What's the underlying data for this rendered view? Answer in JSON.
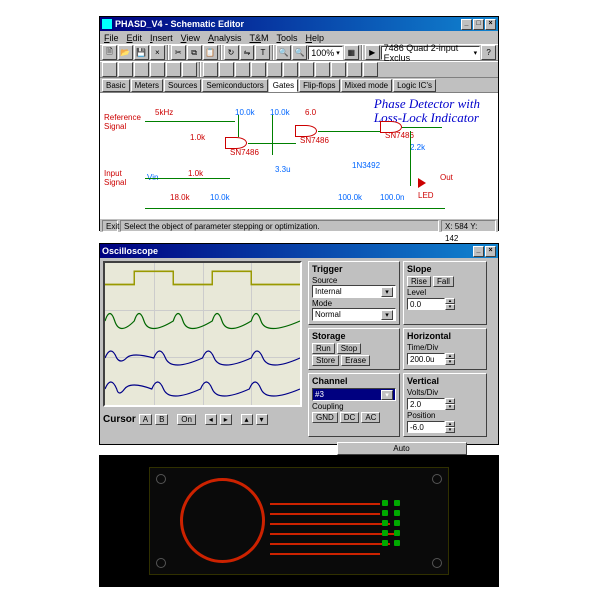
{
  "schematic": {
    "title": "PHASD_V4 - Schematic Editor",
    "menu": [
      "File",
      "Edit",
      "Insert",
      "View",
      "Analysis",
      "T&M",
      "Tools",
      "Help"
    ],
    "zoom": "100%",
    "component_sel": "7486 Quad 2-input Exclus",
    "tabs": [
      "Basic",
      "Meters",
      "Sources",
      "Semiconductors",
      "Gates",
      "Flip-flops",
      "Mixed mode",
      "Logic IC's"
    ],
    "drawing_title_line1": "Phase Detector with",
    "drawing_title_line2": "Loss-Lock Indicator",
    "labels": {
      "ref": "Reference\nSignal",
      "input": "Input\nSignal",
      "freq": "5kHz",
      "r1": "1.0k",
      "r2": "10.0k",
      "r3": "10.0k",
      "r4": "10.0k",
      "r5": "18.0k",
      "r6": "2.2k",
      "r7": "100.0k",
      "c1": "3.3u",
      "c2": "100.0n",
      "c3": "6.0",
      "u1": "SN7486",
      "u2": "SN7486",
      "u3": "SN7486",
      "q1": "1N3492",
      "led": "LED",
      "vin": "Vin",
      "out": "Out"
    },
    "status_icon": "Exit",
    "status_text": "Select the object of parameter stepping or optimization.",
    "status_coord": "X: 584  Y: 142"
  },
  "scope": {
    "title": "Oscilloscope",
    "cursor_label": "Cursor",
    "cursor_a": "A",
    "cursor_b": "B",
    "cursor_on": "On",
    "trigger": {
      "title": "Trigger",
      "source_label": "Source",
      "source": "Internal",
      "mode_label": "Mode",
      "mode": "Normal"
    },
    "slope": {
      "title": "Slope",
      "rise": "Rise",
      "fall": "Fall",
      "level_label": "Level",
      "level": "0.0"
    },
    "storage": {
      "title": "Storage",
      "run": "Run",
      "stop": "Stop",
      "store": "Store",
      "erase": "Erase"
    },
    "horiz": {
      "title": "Horizontal",
      "time_label": "Time/Div",
      "time": "200.0u"
    },
    "channel": {
      "title": "Channel",
      "value": "#3",
      "coupling_label": "Coupling",
      "gnd": "GND",
      "dc": "DC",
      "ac": "AC"
    },
    "vert": {
      "title": "Vertical",
      "volts_label": "Volts/Div",
      "volts": "2.0",
      "pos_label": "Position",
      "pos": "-6.0"
    },
    "auto": "Auto"
  }
}
